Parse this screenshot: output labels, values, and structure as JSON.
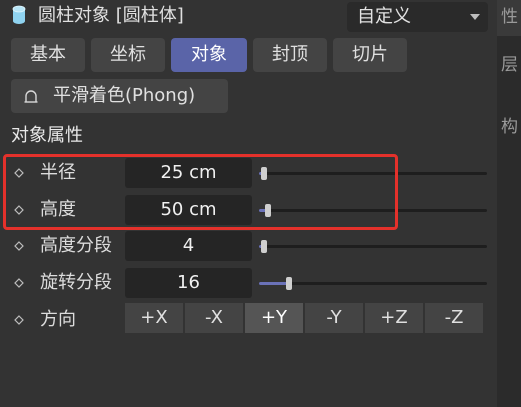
{
  "header": {
    "title": "圆柱对象 [圆柱体]",
    "preset": "自定义",
    "icon": "cylinder-icon"
  },
  "tabs": [
    {
      "label": "基本",
      "active": false
    },
    {
      "label": "坐标",
      "active": false
    },
    {
      "label": "对象",
      "active": true
    },
    {
      "label": "封顶",
      "active": false
    },
    {
      "label": "切片",
      "active": false
    }
  ],
  "phong": {
    "label": "平滑着色(Phong)",
    "icon": "phong-tag-icon"
  },
  "section": {
    "title": "对象属性"
  },
  "properties": {
    "radius": {
      "label": "半径",
      "value": "25 cm",
      "slider_fraction": 0.02
    },
    "height": {
      "label": "高度",
      "value": "50 cm",
      "slider_fraction": 0.04
    },
    "height_segments": {
      "label": "高度分段",
      "value": "4",
      "slider_fraction": 0.02
    },
    "rotation_segments": {
      "label": "旋转分段",
      "value": "16",
      "slider_fraction": 0.13
    },
    "direction": {
      "label": "方向",
      "options": [
        "+X",
        "-X",
        "+Y",
        "-Y",
        "+Z",
        "-Z"
      ],
      "selected": "+Y"
    }
  },
  "side_panel": {
    "chars": [
      "性",
      "层",
      "构"
    ]
  },
  "colors": {
    "accent": "#5a64a8",
    "slider_fill": "#6b72b8",
    "highlight": "#e4312b",
    "cylinder_icon": "#8fd3f0"
  }
}
